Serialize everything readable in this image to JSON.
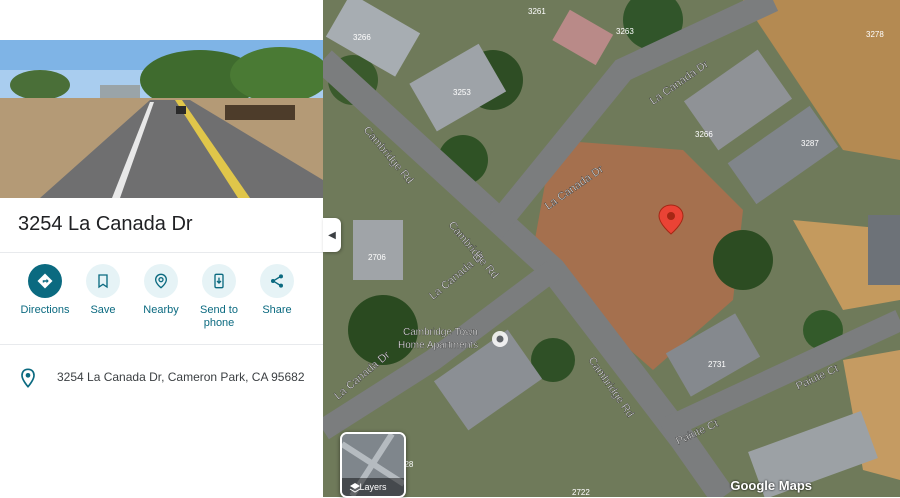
{
  "place": {
    "title": "3254 La Canada Dr",
    "address": "3254 La Canada Dr, Cameron Park, CA 95682"
  },
  "actions": [
    {
      "label": "Directions",
      "icon": "directions-icon"
    },
    {
      "label": "Save",
      "icon": "bookmark-icon"
    },
    {
      "label": "Nearby",
      "icon": "nearby-icon"
    },
    {
      "label": "Send to phone",
      "label_line1": "Send to",
      "label_line2": "phone",
      "icon": "phone-icon"
    },
    {
      "label": "Share",
      "icon": "share-icon"
    }
  ],
  "map": {
    "roads": [
      "Cambridge Rd",
      "La Canada Dr",
      "Paiute Ct"
    ],
    "poi": "Cambridge Town Home Apartments",
    "poi_line1": "Cambridge Town",
    "poi_line2": "Home Apartments",
    "house_numbers": [
      "3266",
      "3261",
      "3263",
      "3278",
      "3253",
      "3266",
      "3287",
      "2706",
      "2731",
      "228",
      "2722"
    ],
    "layers_label": "Layers",
    "attribution": "Google Maps"
  },
  "colors": {
    "accent": "#0b6a80",
    "pin": "#ea4335",
    "accent_light": "#e6f3f6"
  }
}
